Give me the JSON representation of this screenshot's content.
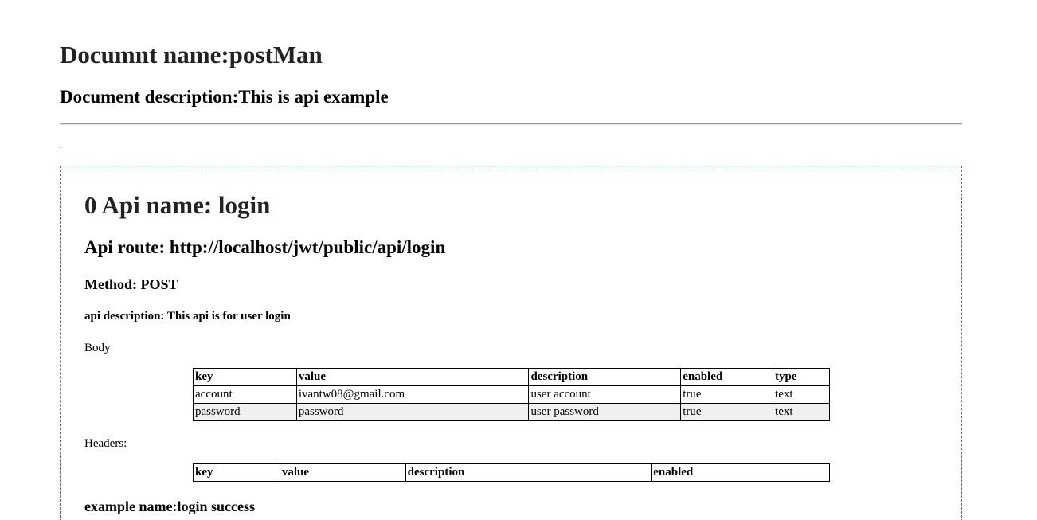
{
  "document": {
    "title": "Documnt name:postMan",
    "description": "Document description:This is api example",
    "separator_mark": "."
  },
  "api": {
    "name": "0 Api name: login",
    "route": "Api route: http://localhost/jwt/public/api/login",
    "method": "Method: POST",
    "description": "api description: This api is for user login",
    "body": {
      "label": "Body",
      "columns": [
        "key",
        "value",
        "description",
        "enabled",
        "type"
      ],
      "rows": [
        [
          "account",
          "ivantw08@gmail.com",
          "user account",
          "true",
          "text"
        ],
        [
          "password",
          "password",
          "user password",
          "true",
          "text"
        ]
      ]
    },
    "headers": {
      "label": "Headers:",
      "columns": [
        "key",
        "value",
        "description",
        "enabled"
      ],
      "rows": []
    },
    "example": {
      "name": "example name:login success"
    }
  },
  "colors": {
    "box_border": "#2e8b3e",
    "alt_row": "#f0f0f0",
    "rule": "#9a9a9a"
  }
}
